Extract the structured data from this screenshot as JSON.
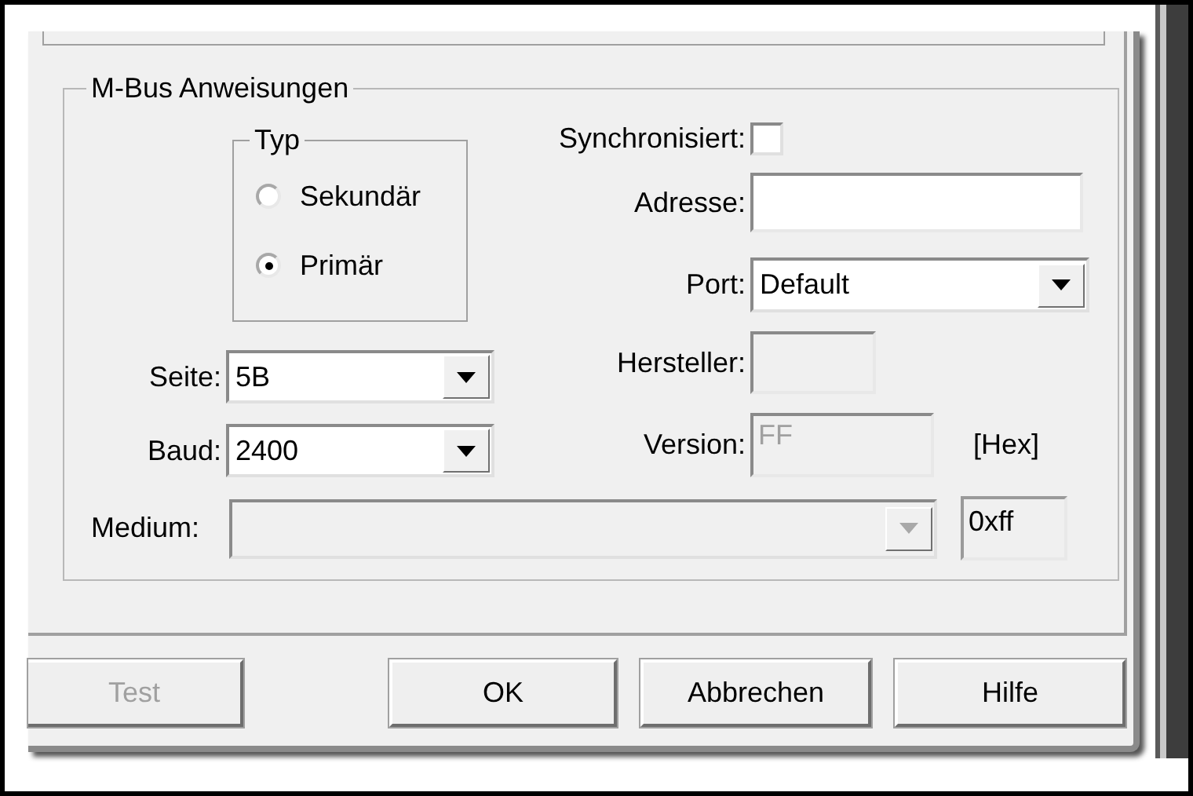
{
  "group": {
    "title": "M-Bus Anweisungen",
    "typ": {
      "title": "Typ",
      "options": [
        {
          "label": "Sekundär",
          "selected": false
        },
        {
          "label": "Primär",
          "selected": true
        }
      ]
    },
    "left_fields": [
      {
        "kind": "combo",
        "label": "Seite:",
        "value": "5B",
        "disabled": false
      },
      {
        "kind": "combo",
        "label": "Baud:",
        "value": "2400",
        "disabled": false
      }
    ],
    "right_fields": [
      {
        "kind": "checkbox",
        "label": "Synchronisiert:",
        "checked": false
      },
      {
        "kind": "text",
        "label": "Adresse:",
        "disabled": false
      },
      {
        "kind": "combo",
        "label": "Port:",
        "value": "Default",
        "disabled": false
      },
      {
        "kind": "text",
        "label": "Hersteller:",
        "disabled": true
      },
      {
        "kind": "text",
        "label": "Version:",
        "value": "FF",
        "disabled": true,
        "suffix": "[Hex]"
      }
    ],
    "medium": {
      "label": "Medium:",
      "disabled": true,
      "code": "0xff"
    }
  },
  "buttons": [
    {
      "label": "Test",
      "disabled": true
    },
    {
      "label": "OK",
      "disabled": false
    },
    {
      "label": "Abbrechen",
      "disabled": false
    },
    {
      "label": "Hilfe",
      "disabled": false
    }
  ]
}
